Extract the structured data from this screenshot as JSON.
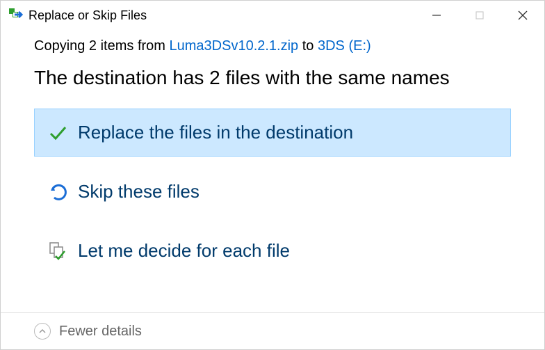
{
  "window": {
    "title": "Replace or Skip Files"
  },
  "status": {
    "prefix": "Copying 2 items from ",
    "source": "Luma3DSv10.2.1.zip",
    "middle": " to ",
    "destination": "3DS (E:)"
  },
  "heading": "The destination has 2 files with the same names",
  "options": {
    "replace": "Replace the files in the destination",
    "skip": "Skip these files",
    "decide": "Let me decide for each file"
  },
  "footer": {
    "details": "Fewer details"
  }
}
